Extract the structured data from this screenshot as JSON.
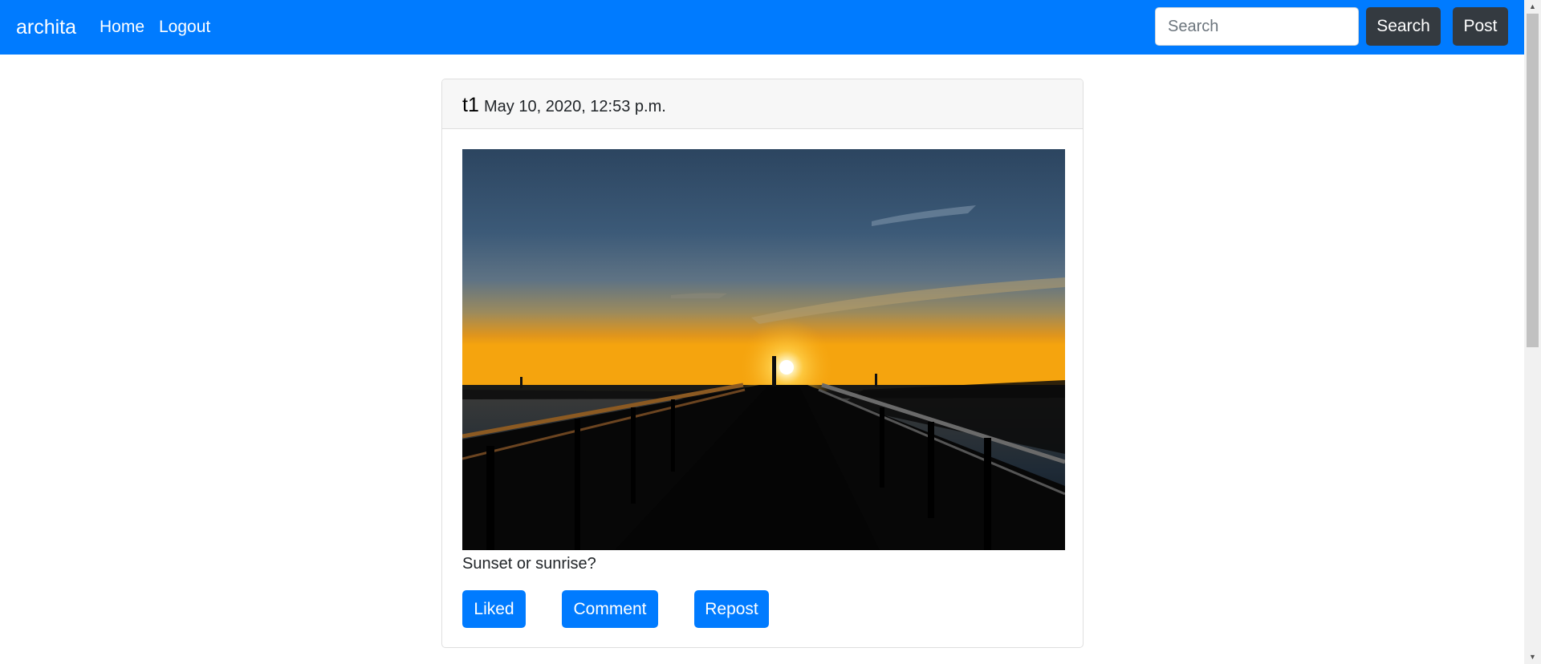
{
  "navbar": {
    "brand": "archita",
    "links": [
      "Home",
      "Logout"
    ],
    "search_placeholder": "Search",
    "search_button": "Search",
    "post_button": "Post",
    "background_color": "#007bff"
  },
  "post": {
    "username": "t1",
    "date": "May 10, 2020, 12:53 p.m.",
    "caption": "Sunset or sunrise?",
    "image_description": "photo of a sunset over a pier",
    "buttons": {
      "liked": "Liked",
      "comment": "Comment",
      "repost": "Repost"
    },
    "button_color": "#007bff"
  }
}
